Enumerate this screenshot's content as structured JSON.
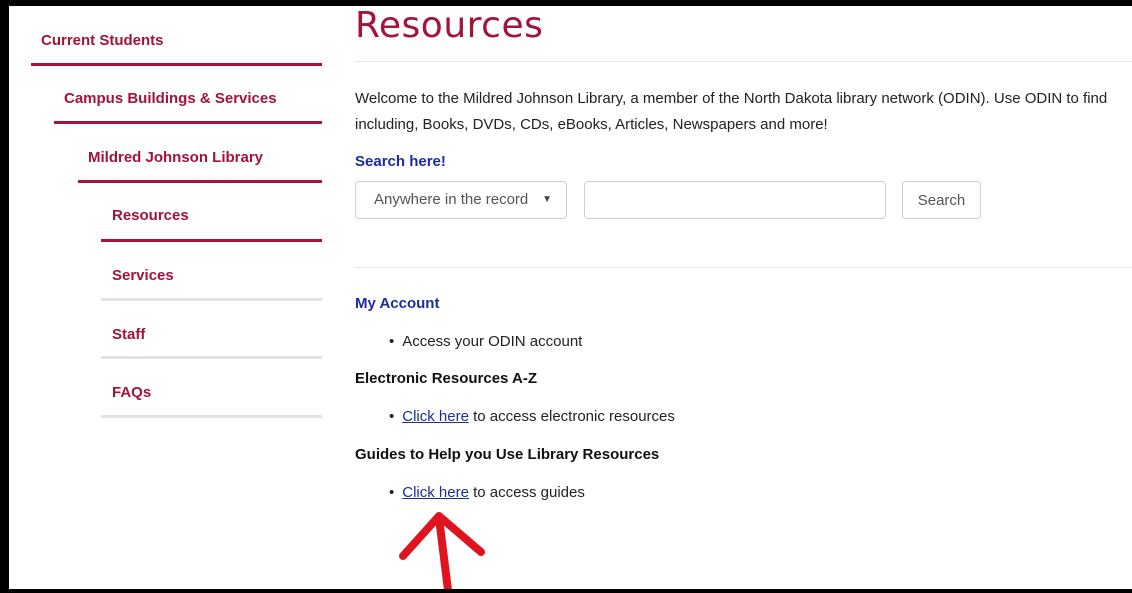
{
  "sidebar": {
    "items": [
      {
        "label": "Current Students",
        "active": true
      },
      {
        "label": "Campus Buildings & Services",
        "active": true
      },
      {
        "label": "Mildred Johnson Library",
        "active": true
      },
      {
        "label": "Resources",
        "active": true
      },
      {
        "label": "Services",
        "active": false
      },
      {
        "label": "Staff",
        "active": false
      },
      {
        "label": "FAQs",
        "active": false
      }
    ]
  },
  "main": {
    "title": "Resources",
    "intro_line1": "Welcome to the Mildred Johnson Library, a member of the North Dakota library network (ODIN). Use ODIN to find",
    "intro_line2": "including, Books, DVDs, CDs, eBooks, Articles, Newspapers and more!",
    "search": {
      "heading": "Search here!",
      "scope_selected": "Anywhere in the record",
      "input_value": "",
      "input_placeholder": "",
      "button_label": "Search"
    },
    "my_account": {
      "heading": "My Account",
      "item": "Access your ODIN account"
    },
    "electronic": {
      "heading": "Electronic Resources A-Z",
      "link": "Click here",
      "rest": " to access electronic resources"
    },
    "guides": {
      "heading": "Guides to Help you Use Library Resources",
      "link": "Click here",
      "rest": " to access guides"
    }
  },
  "colors": {
    "brand_red": "#a3133a",
    "link_blue": "#1b2e9c",
    "annotation_red": "#e0141e"
  },
  "icons": {
    "select_caret": "caret-down-icon",
    "annotation": "red-arrow-up-icon"
  }
}
